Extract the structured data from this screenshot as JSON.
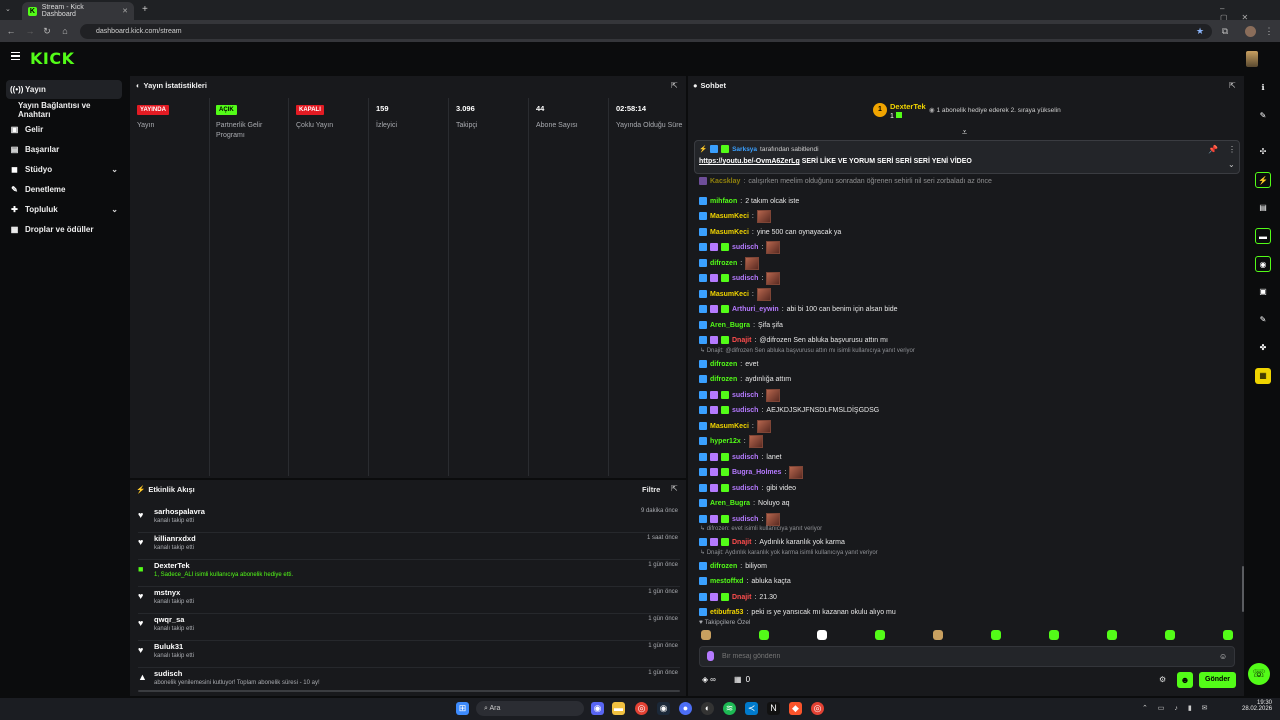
{
  "browser": {
    "tab_title": "Stream - Kick Dashboard",
    "url": "dashboard.kick.com/stream",
    "new_tab": "+"
  },
  "header": {
    "logo": "KICK"
  },
  "sidebar": {
    "items": [
      {
        "label": "Yayın",
        "icon": "broadcast-icon"
      },
      {
        "label": "Yayın Bağlantısı ve Anahtarı",
        "icon": ""
      },
      {
        "label": "Gelir",
        "icon": "wallet-icon"
      },
      {
        "label": "Başarılar",
        "icon": "trophy-icon"
      },
      {
        "label": "Stüdyo",
        "icon": "studio-icon"
      },
      {
        "label": "Denetleme",
        "icon": "wrench-icon"
      },
      {
        "label": "Topluluk",
        "icon": "community-icon"
      },
      {
        "label": "Droplar ve ödüller",
        "icon": "gift-icon"
      }
    ]
  },
  "stats": {
    "title": "Yayın İstatistikleri",
    "items": [
      {
        "badge": "YAYINDA",
        "badge_color": "#e31b23",
        "label": "Yayın"
      },
      {
        "badge": "AÇIK",
        "badge_color": "#53fc18",
        "label": "Partnerlik Gelir Programı"
      },
      {
        "badge": "KAPALI",
        "badge_color": "#e31b23",
        "label": "Çoklu Yayın"
      },
      {
        "value": "159",
        "label": "İzleyici"
      },
      {
        "value": "3.096",
        "label": "Takipçi"
      },
      {
        "value": "44",
        "label": "Abone Sayısı"
      },
      {
        "value": "02:58:14",
        "label": "Yayında Olduğu Süre"
      }
    ]
  },
  "activity": {
    "title": "Etkinlik Akışı",
    "filter": "Filtre",
    "items": [
      {
        "name": "sarhospalavra",
        "sub": "kanalı takip etti",
        "time": "9 dakika önce",
        "icon": "♥"
      },
      {
        "name": "killianrxdxd",
        "sub": "kanalı takip etti",
        "time": "1 saat önce",
        "icon": "♥"
      },
      {
        "name": "DexterTek",
        "sub": "1, Sadece_ALI isimli kullanıcıya abonelik hediye etti.",
        "time": "1 gün önce",
        "icon": "■"
      },
      {
        "name": "mstnyx",
        "sub": "kanalı takip etti",
        "time": "1 gün önce",
        "icon": "♥"
      },
      {
        "name": "qwqr_sa",
        "sub": "kanalı takip etti",
        "time": "1 gün önce",
        "icon": "♥"
      },
      {
        "name": "Buluk31",
        "sub": "kanalı takip etti",
        "time": "1 gün önce",
        "icon": "♥"
      },
      {
        "name": "sudisch",
        "sub": "abonelik yenilemesini kutluyor! Toplam abonelik süresi - 10 ay!",
        "time": "1 gün önce",
        "icon": "▲"
      }
    ]
  },
  "chat": {
    "title": "Sohbet",
    "top_gifter": {
      "name": "DexterTek",
      "count": "1",
      "rank": "1",
      "note": "1 abonelik hediye ederek 2. sıraya yükselin"
    },
    "pinned": {
      "by": "Sarksya",
      "by_suffix": "tarafından sabitlendi",
      "link": "https://youtu.be/-OvmA6ZerLg",
      "text": "SERİ LİKE VE YORUM SERİ SERİ SERİ YENİ VİDEO"
    },
    "partial": {
      "user": "Kacsklay",
      "text": "calışırken meelim olduğunu sonradan öğrenen sehirli nil seri zorbaladı az önce"
    },
    "messages": [
      {
        "user": "mihfaon",
        "color": "#53fc18",
        "text": "2 takım olcak iste"
      },
      {
        "user": "MasumKeci",
        "color": "#f0d400",
        "text": "",
        "emote": true
      },
      {
        "user": "MasumKeci",
        "color": "#f0d400",
        "text": "yine 500 can oynayacak ya"
      },
      {
        "user": "sudisch",
        "color": "#b57aff",
        "text": "",
        "emote": true
      },
      {
        "user": "difrozen",
        "color": "#53fc18",
        "text": "",
        "emote": true
      },
      {
        "user": "sudisch",
        "color": "#b57aff",
        "text": "",
        "emote": true
      },
      {
        "user": "MasumKeci",
        "color": "#f0d400",
        "text": "",
        "emote": true
      },
      {
        "user": "Arthuri_eywin",
        "color": "#b57aff",
        "text": "abi bi 100 can benim için alsan bide"
      },
      {
        "user": "Aren_Bugra",
        "color": "#53fc18",
        "text": "Şifa şifa"
      },
      {
        "user": "Dnajit",
        "color": "#ff4d4d",
        "text": "@difrozen Sen abluka başvurusu attın mı"
      },
      {
        "user": "difrozen",
        "color": "#53fc18",
        "text": "evet"
      },
      {
        "user": "difrozen",
        "color": "#53fc18",
        "text": "aydınlığa attım"
      },
      {
        "user": "sudisch",
        "color": "#b57aff",
        "text": "",
        "emote": true
      },
      {
        "user": "sudisch",
        "color": "#b57aff",
        "text": "AEJKDJSKJFNSDLFMSLDİŞGDSG"
      },
      {
        "user": "MasumKeci",
        "color": "#f0d400",
        "text": "",
        "emote": true
      },
      {
        "user": "hyper12x",
        "color": "#53fc18",
        "text": "",
        "emote": true
      },
      {
        "user": "sudisch",
        "color": "#b57aff",
        "text": "lanet"
      },
      {
        "user": "Bugra_Holmes",
        "color": "#b57aff",
        "text": "",
        "emote": true
      },
      {
        "user": "sudisch",
        "color": "#b57aff",
        "text": "gibi video"
      },
      {
        "user": "Aren_Bugra",
        "color": "#53fc18",
        "text": "Noluyo aq"
      },
      {
        "user": "sudisch",
        "color": "#b57aff",
        "text": "",
        "emote": true
      },
      {
        "user": "Dnajit",
        "color": "#ff4d4d",
        "text": "Aydınlık karanlık yok karma"
      },
      {
        "user": "difrozen",
        "color": "#53fc18",
        "text": "biliyom"
      },
      {
        "user": "mestoffxd",
        "color": "#53fc18",
        "text": "abluka kaçta"
      },
      {
        "user": "Dnajit",
        "color": "#ff4d4d",
        "text": "21.30"
      },
      {
        "user": "etibufra53",
        "color": "#f0d400",
        "text": "peki ıs ye yansıcak mı kazanan okulu alıyo mu"
      }
    ],
    "replies": [
      "Dnajit: @difrozen Sen abluka başvurusu attın mı isimli kullanıcıya yanıt veriyor",
      "difrozen: evet isimli kullanıcıya yanıt veriyor",
      "Dnajit: Aydınlık karanlık yok karma isimli kullanıcıya yanıt veriyor"
    ],
    "followers_only": "Takipçilere Özel",
    "input_placeholder": "Bir mesaj gönderin",
    "points": "∞",
    "gift_count": "0",
    "send": "Gönder"
  },
  "taskbar": {
    "search": "Ara",
    "time": "19:30",
    "date": "28.02.2026"
  },
  "colors": {
    "accent": "#53fc18",
    "live": "#e31b23",
    "panel": "#18191c"
  }
}
